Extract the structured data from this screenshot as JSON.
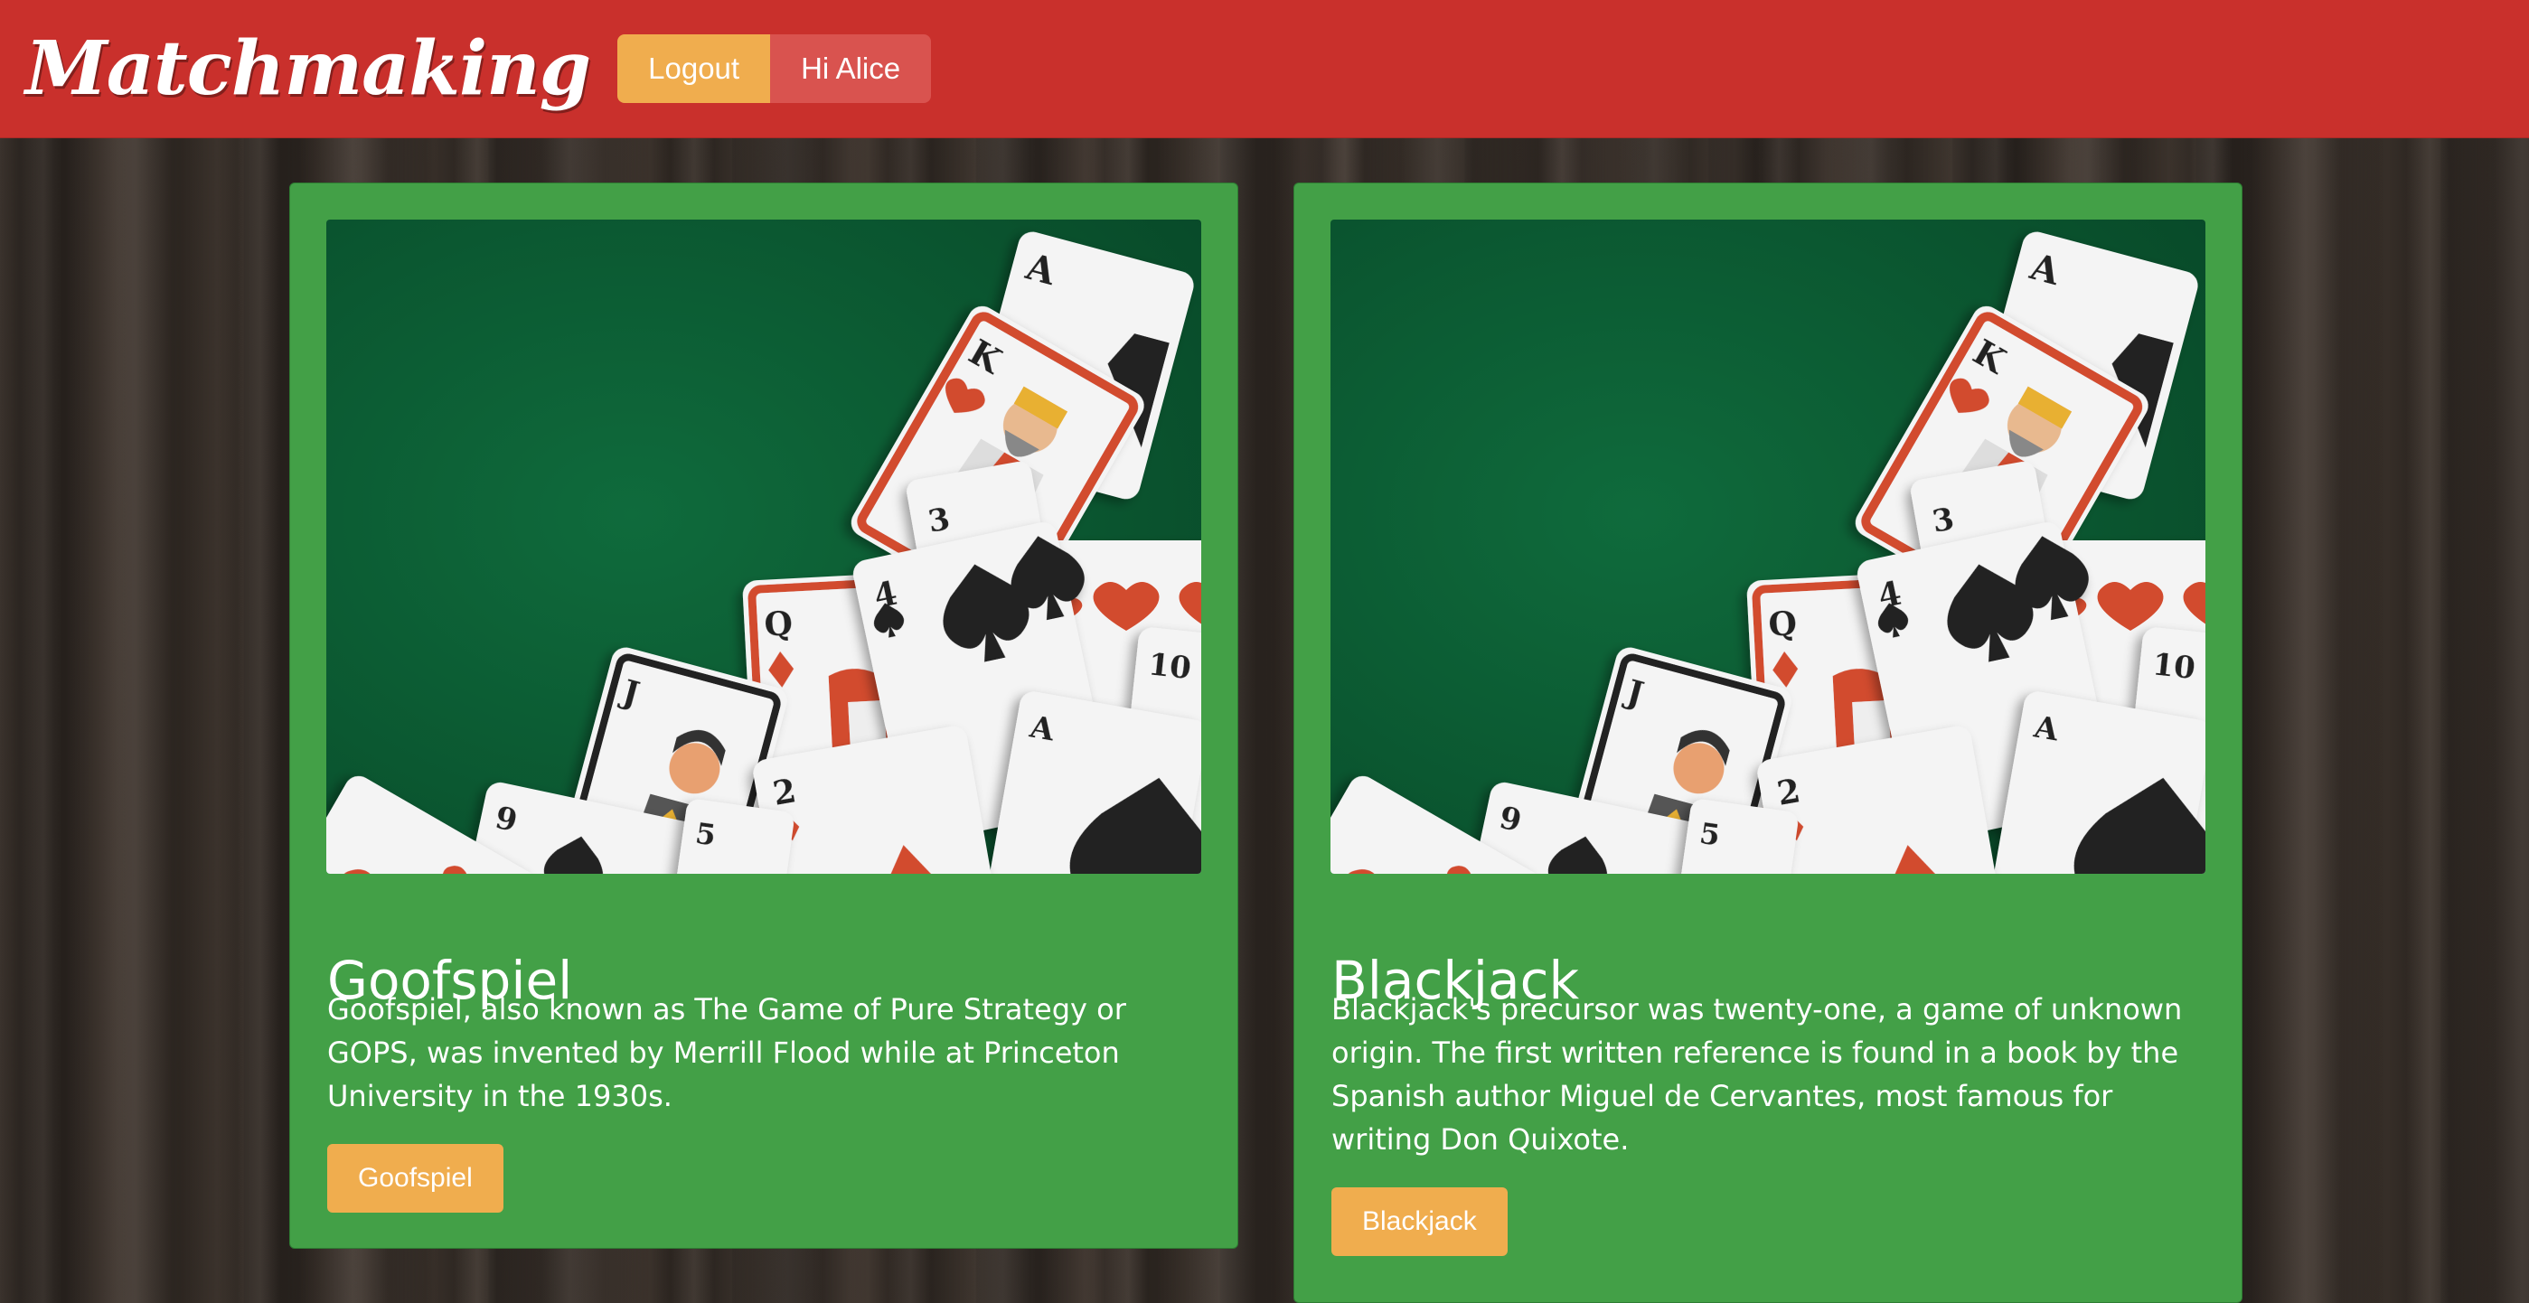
{
  "navbar": {
    "brand": "Matchmaking",
    "logout_label": "Logout",
    "user_label": "Hi Alice"
  },
  "games": [
    {
      "title": "Goofspiel",
      "description": "Goofspiel, also known as The Game of Pure Strategy or GOPS, was invented by Merrill Flood while at Princeton University in the 1930s.",
      "button_label": "Goofspiel"
    },
    {
      "title": "Blackjack",
      "description": "Blackjack's precursor was twenty-one, a game of unknown origin. The first written reference is found in a book by the Spanish author Miguel de Cervantes, most famous for writing Don Quixote.",
      "button_label": "Blackjack"
    }
  ],
  "card_art": {
    "felt_color": "#0b5a32",
    "card_ranks": [
      "A",
      "K",
      "3",
      "6",
      "Q",
      "4",
      "10",
      "J",
      "A",
      "9",
      "5",
      "2"
    ]
  },
  "colors": {
    "navbar": "#c9302c",
    "card": "#43a047",
    "button": "#f0ad4e",
    "user_button": "#d9534f"
  }
}
